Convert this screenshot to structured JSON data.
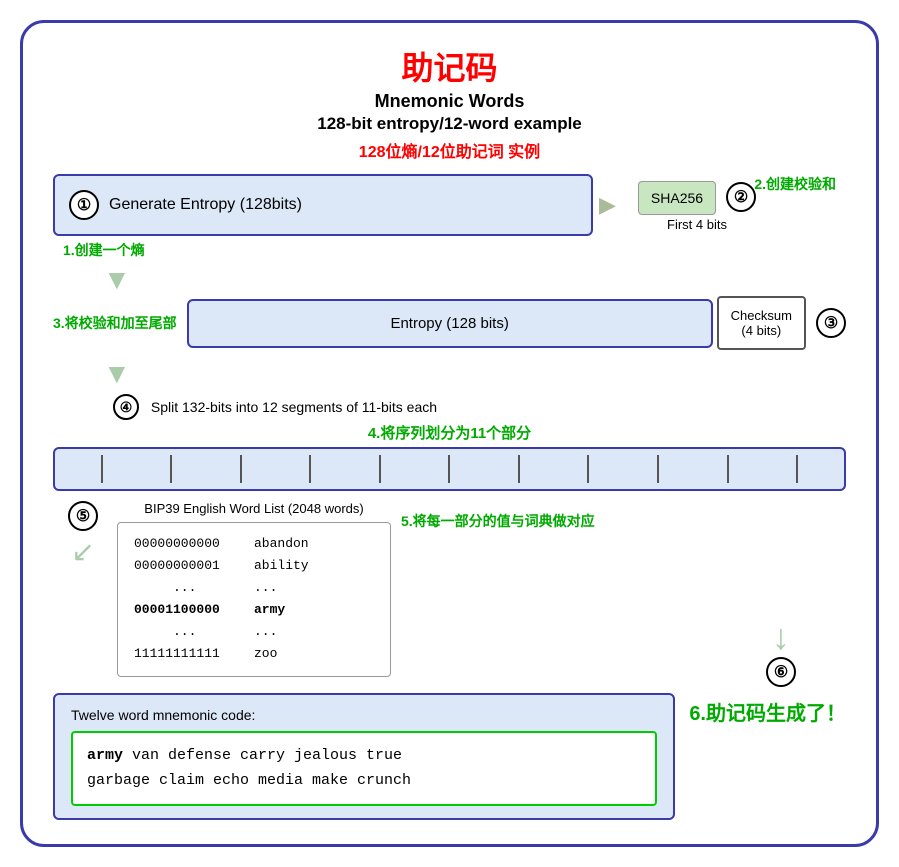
{
  "title": {
    "main": "助记码",
    "sub1": "Mnemonic Words",
    "sub2": "128-bit entropy/12-word example",
    "sub_cn": "128位熵/12位助记词 实例"
  },
  "step1": {
    "circle": "①",
    "label": "Generate Entropy (128bits)",
    "annotation": "1.创建一个熵"
  },
  "step2": {
    "circle": "②",
    "sha_label": "SHA256",
    "first4": "First 4 bits",
    "annotation": "2.创建校验和"
  },
  "step3": {
    "annotation": "3.将校验和加至尾部",
    "entropy_label": "Entropy (128 bits)",
    "checksum_label": "Checksum\n(4 bits)",
    "circle": "③"
  },
  "step4": {
    "circle": "④",
    "text": "Split 132-bits into 12 segments of 11-bits each",
    "annotation": "4.将序列划分为11个部分"
  },
  "step5": {
    "circle": "⑤",
    "list_title": "BIP39 English Word List (2048 words)",
    "annotation": "5.将每一部分的值与词典做对应",
    "rows": [
      {
        "num": "00000000000",
        "word": "abandon"
      },
      {
        "num": "00000000001",
        "word": "ability"
      },
      {
        "num": "...",
        "word": "..."
      },
      {
        "num": "00001100000",
        "word": "army",
        "highlight": true
      },
      {
        "num": "...",
        "word": "..."
      },
      {
        "num": "11111111111",
        "word": "zoo"
      }
    ]
  },
  "step6": {
    "circle": "⑥",
    "title": "Twelve word mnemonic code:",
    "annotation": "6.助记码生成了！",
    "mnemonic_bold": "army",
    "mnemonic_rest": " van defense carry jealous true\ngarbage claim echo media make crunch"
  }
}
